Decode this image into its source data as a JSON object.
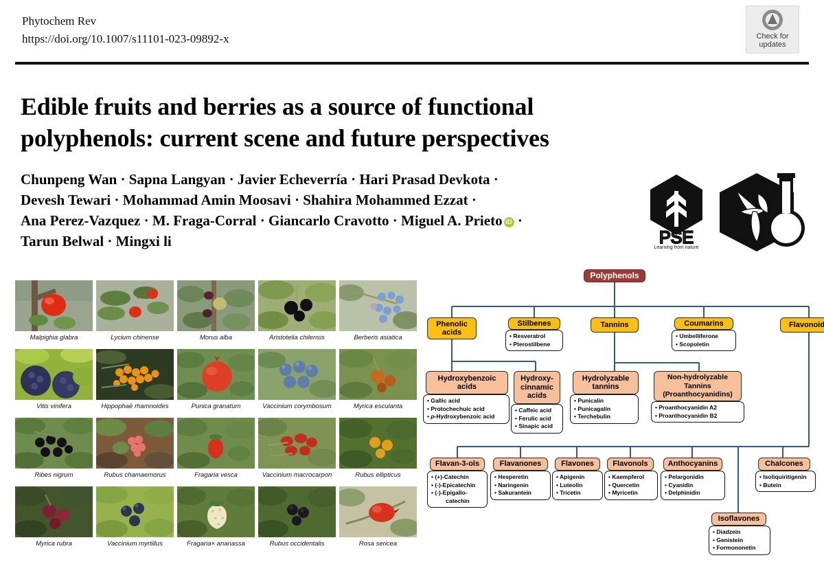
{
  "header": {
    "journal": "Phytochem Rev",
    "doi": "https://doi.org/10.1007/s11101-023-09892-x",
    "check_updates_line1": "Check for",
    "check_updates_line2": "updates",
    "check_updates_icon": "refresh-circle-icon"
  },
  "title": "Edible fruits and berries as a source of functional polyphenols: current scene and future perspectives",
  "authors": {
    "lines": [
      "Chunpeng Wan · Sapna Langyan · Javier Echeverría · Hari Prasad Devkota ·",
      "Devesh Tewari · Mohammad Amin Moosavi · Shahira Mohammed Ezzat ·",
      "Ana Perez-Vazquez · M. Fraga-Corral · Giancarlo Cravotto · Miguel A. Prieto",
      "Tarun Belwal · Mingxi li"
    ],
    "orcid_label": "iD",
    "orcid_color": "#a6ce39",
    "trailing_separator": "·"
  },
  "logos": {
    "pse_text": "PSE",
    "pse_tagline": "Learning from nature",
    "plant_logo_name": "plant-flask-hexagon-logo"
  },
  "fruit_grid": [
    {
      "caption": "Malpighia glabra",
      "photo": "malpighia-glabra"
    },
    {
      "caption": "Lycium chinense",
      "photo": "lycium-chinense"
    },
    {
      "caption": "Morus alba",
      "photo": "morus-alba"
    },
    {
      "caption": "Aristotelia chilensis",
      "photo": "aristotelia-chilensis"
    },
    {
      "caption": "Berberis asiatica",
      "photo": "berberis-asiatica"
    },
    {
      "caption": "Vitis vinifera",
      "photo": "vitis-vinifera"
    },
    {
      "caption": "Hippophaë rhamnoides",
      "photo": "hippophae-rhamnoides"
    },
    {
      "caption": "Punica granatum",
      "photo": "punica-granatum"
    },
    {
      "caption": "Vaccinium corymbosum",
      "photo": "vaccinium-corymbosum"
    },
    {
      "caption": "Myrica esculanta",
      "photo": "myrica-esculanta"
    },
    {
      "caption": "Ribes nigrum",
      "photo": "ribes-nigrum"
    },
    {
      "caption": "Rubus chamaemorus",
      "photo": "rubus-chamaemorus"
    },
    {
      "caption": "Fragaria vesca",
      "photo": "fragaria-vesca"
    },
    {
      "caption": "Vaccinium macrocarpon",
      "photo": "vaccinium-macrocarpon"
    },
    {
      "caption": "Rubus ellipticus",
      "photo": "rubus-ellipticus"
    },
    {
      "caption": "Myrica rubra",
      "photo": "myrica-rubra"
    },
    {
      "caption": "Vaccinium myrtillus",
      "photo": "vaccinium-myrtillus"
    },
    {
      "caption": "Fragaria× ananassa",
      "photo": "fragaria-ananassa"
    },
    {
      "caption": "Rubus occidentalis",
      "photo": "rubus-occidentalis"
    },
    {
      "caption": "Rosa sericea",
      "photo": "rosa-sericea"
    }
  ],
  "flowchart": {
    "colors": {
      "root": "#9c3a38",
      "level1": "#fdc010",
      "level2": "#f6c09a",
      "connector": "#2e5c86",
      "box_border": "#111111"
    },
    "root": "Polyphenols",
    "level1": [
      {
        "label": "Phenolic acids",
        "items": []
      },
      {
        "label": "Stilbenes",
        "items": [
          "Resveratrol",
          "Pterostilbene"
        ]
      },
      {
        "label": "Tannins",
        "items": []
      },
      {
        "label": "Coumarins",
        "items": [
          "Umbelliferone",
          "Scopoletin"
        ]
      },
      {
        "label": "Flavonoids",
        "items": []
      }
    ],
    "level2": [
      {
        "label": "Hydroxybenzoic acids",
        "items": [
          "Gallic acid",
          "Protochechuic acid",
          "p-Hydroxybenzoic acid"
        ]
      },
      {
        "label": "Hydroxy-cinnamic acids",
        "items": [
          "Caffeic acid",
          "Ferulic acid",
          "Sinapic acid"
        ]
      },
      {
        "label": "Hydrolyzable tannins",
        "items": [
          "Punicalin",
          "Punicagalin",
          "Terchebulin"
        ]
      },
      {
        "label": "Non-hydrolyzable Tannins (Proanthocyanidins)",
        "items": [
          "Proanthocyanidin A2",
          "Proanthocyanidin B2"
        ]
      }
    ],
    "flavonoid_classes": [
      {
        "label": "Flavan-3-ols",
        "items": [
          "(+)-Catechin",
          "(-)-Epicatechin",
          "(-)-Epigallo-catechin"
        ]
      },
      {
        "label": "Flavanones",
        "items": [
          "Hesperetin",
          "Naringenin",
          "Sakurantein"
        ]
      },
      {
        "label": "Flavones",
        "items": [
          "Apigenin",
          "Luteolin",
          "Tricetin"
        ]
      },
      {
        "label": "Flavonols",
        "items": [
          "Kaempferol",
          "Quercetin",
          "Myricetin"
        ]
      },
      {
        "label": "Anthocyanins",
        "items": [
          "Pelargonidin",
          "Cyanidin",
          "Delphinidin"
        ]
      },
      {
        "label": "Chalcones",
        "items": [
          "Isoliquiritigenin",
          "Butein"
        ]
      },
      {
        "label": "Isoflavones",
        "items": [
          "Diadzein",
          "Genistein",
          "Formononetin"
        ]
      }
    ]
  }
}
